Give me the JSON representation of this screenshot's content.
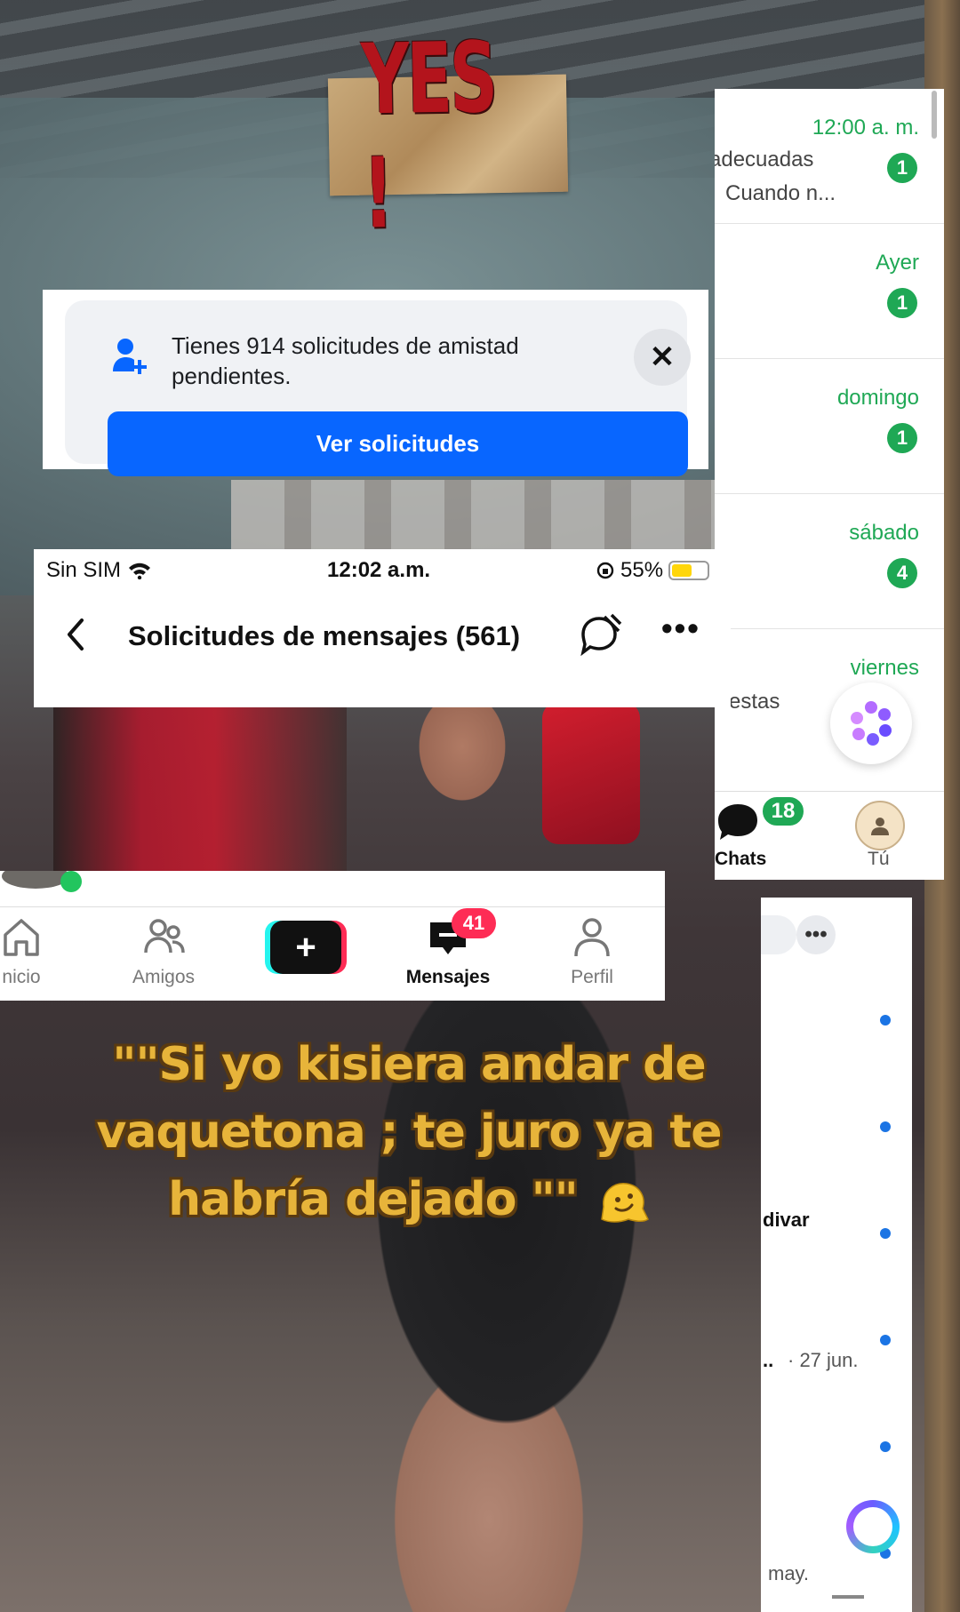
{
  "sticker": {
    "text": "YES !"
  },
  "friend_request_card": {
    "text": "Tienes 914 solicitudes de amistad pendientes.",
    "button_label": "Ver solicitudes",
    "close_symbol": "✕",
    "icon": "add-friend-icon",
    "accent": "#0866ff"
  },
  "message_requests": {
    "status": {
      "carrier": "Sin SIM",
      "time": "12:02 a.m.",
      "battery": "55%"
    },
    "title": "Solicitudes de mensajes (561)",
    "more_symbol": "•••"
  },
  "chat_list": {
    "accent": "#1fa855",
    "rows": [
      {
        "time": "12:00 a. m.",
        "badge": "1",
        "preview": "adecuadas",
        "preview2": "Cuando n..."
      },
      {
        "time": "Ayer",
        "badge": "1",
        "preview": ""
      },
      {
        "time": "domingo",
        "badge": "1",
        "preview": ""
      },
      {
        "time": "sábado",
        "badge": "4",
        "preview": ""
      },
      {
        "time": "viernes",
        "badge": "",
        "preview": "estas"
      }
    ],
    "tabs": {
      "chats_label": "Chats",
      "chats_badge": "18",
      "profile_label": "Tú"
    }
  },
  "tiktok_nav": {
    "items": [
      {
        "label": "nicio",
        "icon": "home-icon"
      },
      {
        "label": "Amigos",
        "icon": "friends-icon"
      },
      {
        "label": "+",
        "icon": "create-icon"
      },
      {
        "label": "Mensajes",
        "icon": "inbox-icon"
      },
      {
        "label": "Perfil",
        "icon": "profile-icon"
      }
    ],
    "messages_badge": "41"
  },
  "fb_list": {
    "more_symbol": "•••",
    "labels": {
      "divar": "divar",
      "date_prefix": "..",
      "date": "· 27 jun.",
      "may": "may."
    }
  },
  "caption": {
    "line1": "\"\"Si yo kisiera andar de",
    "line2": "vaquetona ; te juro ya te",
    "line3": "habría dejado \"\""
  }
}
